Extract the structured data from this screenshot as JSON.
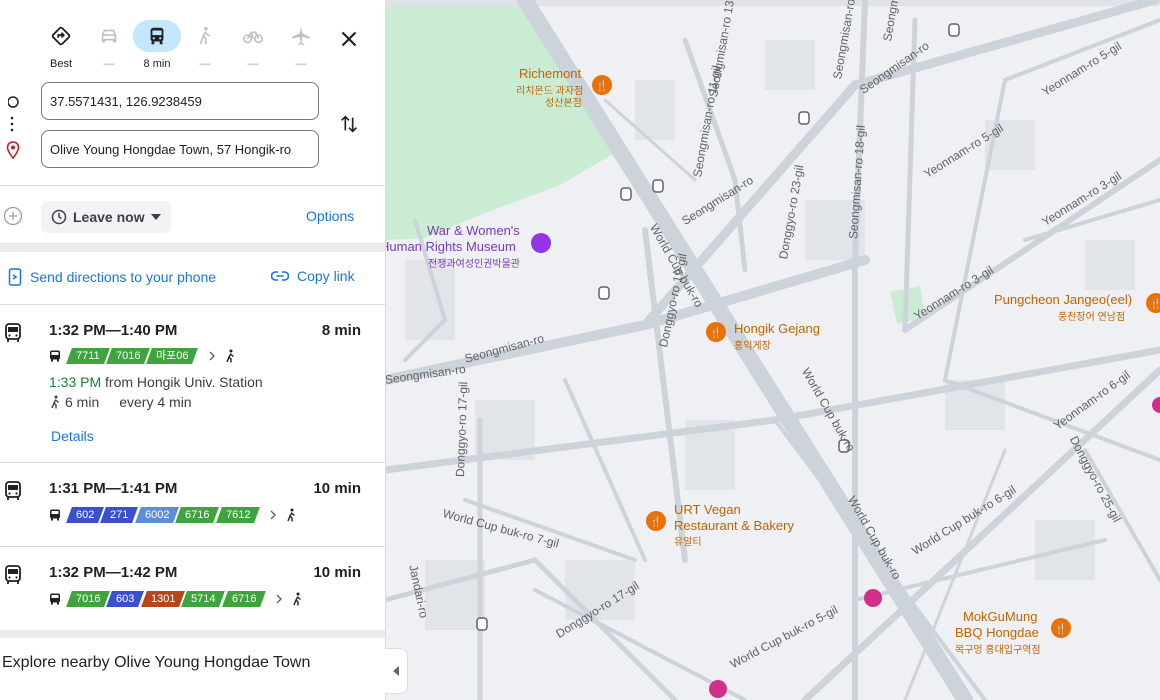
{
  "modes": [
    {
      "name": "best",
      "label": "Best"
    },
    {
      "name": "driving",
      "label": "—"
    },
    {
      "name": "transit",
      "label": "8 min"
    },
    {
      "name": "walking",
      "label": "—"
    },
    {
      "name": "cycling",
      "label": "—"
    },
    {
      "name": "flights",
      "label": "—"
    }
  ],
  "origin": {
    "value": "37.5571431, 126.9238459"
  },
  "destination": {
    "value": "Olive Young Hongdae Town, 57 Hongik-ro"
  },
  "leave": {
    "label": "Leave now"
  },
  "options_label": "Options",
  "send_label": "Send directions to your phone",
  "copy_label": "Copy link",
  "routes": [
    {
      "time": "1:32 PM—1:40 PM",
      "duration": "8 min",
      "buses": [
        {
          "num": "7711",
          "color": "#3fa33e"
        },
        {
          "num": "7016",
          "color": "#3fa33e"
        },
        {
          "num": "마포06",
          "color": "#3fa33e"
        }
      ],
      "depart_time": "1:33 PM",
      "depart_text": "from Hongik Univ. Station",
      "walk": "6 min",
      "freq": "every 4 min",
      "details": "Details"
    },
    {
      "time": "1:31 PM—1:41 PM",
      "duration": "10 min",
      "buses": [
        {
          "num": "602",
          "color": "#3b4fd1"
        },
        {
          "num": "271",
          "color": "#3b4fd1"
        },
        {
          "num": "6002",
          "color": "#5a8fd8"
        },
        {
          "num": "6716",
          "color": "#3fa33e"
        },
        {
          "num": "7612",
          "color": "#3fa33e"
        }
      ]
    },
    {
      "time": "1:32 PM—1:42 PM",
      "duration": "10 min",
      "buses": [
        {
          "num": "7016",
          "color": "#3fa33e"
        },
        {
          "num": "603",
          "color": "#3b4fd1"
        },
        {
          "num": "1301",
          "color": "#b4481c"
        },
        {
          "num": "5714",
          "color": "#3fa33e"
        },
        {
          "num": "6716",
          "color": "#3fa33e"
        }
      ]
    }
  ],
  "explore_label": "Explore nearby Olive Young Hongdae Town",
  "map": {
    "pois": [
      {
        "name": "Richemont",
        "sub1": "리치몬드 과자점",
        "sub2": "성산본점",
        "color": "#e8710a"
      },
      {
        "name": "War & Women's",
        "name2": "Human Rights Museum",
        "sub1": "전쟁과여성인권박물관",
        "color": "#9334e6"
      },
      {
        "name": "Hongik Gejang",
        "sub1": "홍익게장",
        "color": "#e8710a"
      },
      {
        "name": "Pungcheon Jangeo(eel)",
        "sub1": "풍천장어 연남점",
        "color": "#e8710a"
      },
      {
        "name": "URT Vegan",
        "name2": "Restaurant & Bakery",
        "sub1": "유알티",
        "color": "#e8710a"
      },
      {
        "name": "MokGuMung",
        "name2": "BBQ Hongdae",
        "sub1": "목구멍 홍대입구역점",
        "color": "#e8710a"
      }
    ],
    "streets": [
      "Seongmisan-ro 17-gil",
      "Seongmisan-ro",
      "Yeonnam-ro 5-gil",
      "Seongmisan-ro 13-gil",
      "Seongmisan-ro 11-gil",
      "Seongmisan-ro 18-gil",
      "Donggyo-ro 23-gil",
      "Seongmisan-ro",
      "World Cup buk-ro",
      "Yeonnam-ro 5-gil",
      "Donggyo-ro 19-gil",
      "Yeonnam-ro 3-gil",
      "Seongmisan-ro",
      "Donggyo-ro 17-gil",
      "World Cup buk-ro",
      "World Cup buk-ro 7-gil",
      "World Cup buk-ro",
      "World Cup buk-ro 6-gil",
      "Donggyo-ro 25-gil",
      "Yeonnam-ro 6-gil",
      "World Cup buk-ro 5-gil",
      "Donggyo-ro 17-gil",
      "Jandari-ro",
      "Yeonnam-ro 3-gil",
      "Seongmisan-ro",
      "Seongmisan-ro",
      "Hongik Gejang"
    ]
  }
}
